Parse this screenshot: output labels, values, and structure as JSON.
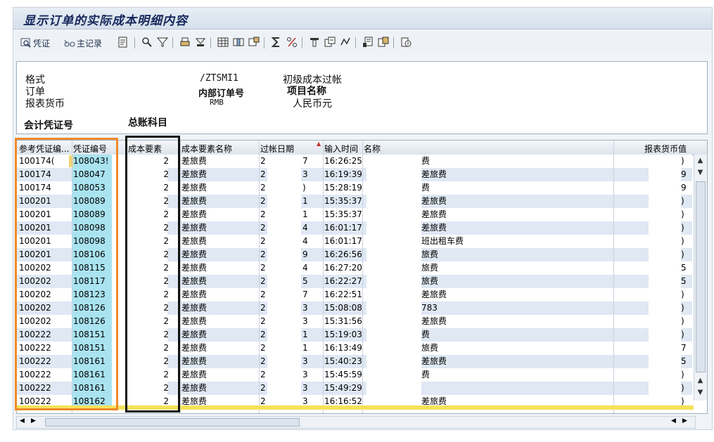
{
  "title": "显示订单的实际成本明细内容",
  "toolbar": {
    "voucher_label": "凭证",
    "master_label": "主记录"
  },
  "header": {
    "format_label": "格式",
    "format_value": "/ZTSMI1",
    "format_desc": "初级成本过帐",
    "order_label": "订单",
    "order_value": "内部订单号",
    "order_desc": "项目名称",
    "currency_label": "报表货币",
    "currency_value": "RMB",
    "currency_desc": "人民币元",
    "voucher_no_label": "会计凭证号",
    "gl_account_label": "总账科目"
  },
  "columns": [
    "参考凭证编...",
    "凭证编号",
    "成本要素",
    "成本要素名称",
    "过帐日期",
    "输入时间",
    "名称",
    "",
    "报表货币值"
  ],
  "rows": [
    {
      "ref": "100174(",
      "doc": "108043!",
      "ce": "2",
      "cename": "差旅费",
      "d1": "2",
      "d2": "7",
      "time": "16:26:25",
      "name": "费",
      "val": ")"
    },
    {
      "ref": "100174",
      "doc": "108047",
      "ce": "2",
      "cename": "差旅费",
      "d1": "2",
      "d2": "3",
      "time": "16:19:39",
      "name": "差旅费",
      "val": "9"
    },
    {
      "ref": "100174",
      "doc": "108053",
      "ce": "2",
      "cename": "差旅费",
      "d1": "2",
      "d2": ")",
      "time": "15:28:19",
      "name": "费",
      "val": "9"
    },
    {
      "ref": "100201",
      "doc": "108089",
      "ce": "2",
      "cename": "差旅费",
      "d1": "2",
      "d2": "1",
      "time": "15:35:37",
      "name": "差旅费",
      "val": ")"
    },
    {
      "ref": "100201",
      "doc": "108089",
      "ce": "2",
      "cename": "差旅费",
      "d1": "2",
      "d2": "1",
      "time": "15:35:37",
      "name": "差旅费",
      "val": ")"
    },
    {
      "ref": "100201",
      "doc": "108098",
      "ce": "2",
      "cename": "差旅费",
      "d1": "2",
      "d2": "4",
      "time": "16:01:17",
      "name": "差旅费",
      "val": ")"
    },
    {
      "ref": "100201",
      "doc": "108098",
      "ce": "2",
      "cename": "差旅费",
      "d1": "2",
      "d2": "4",
      "time": "16:01:17",
      "name": "班出租车费",
      "val": ")"
    },
    {
      "ref": "100201",
      "doc": "108106",
      "ce": "2",
      "cename": "差旅费",
      "d1": "2",
      "d2": "9",
      "time": "16:26:56",
      "name": "旅费",
      "val": ")"
    },
    {
      "ref": "100202",
      "doc": "108115",
      "ce": "2",
      "cename": "差旅费",
      "d1": "2",
      "d2": "4",
      "time": "16:27:20",
      "name": "旅费",
      "val": "5"
    },
    {
      "ref": "100202",
      "doc": "108117",
      "ce": "2",
      "cename": "差旅费",
      "d1": "2",
      "d2": "5",
      "time": "16:22:27",
      "name": "旅费",
      "val": "5"
    },
    {
      "ref": "100202",
      "doc": "108123",
      "ce": "2",
      "cename": "差旅费",
      "d1": "2",
      "d2": "7",
      "time": "16:22:51",
      "name": "差旅费",
      "val": ")"
    },
    {
      "ref": "100202",
      "doc": "108126",
      "ce": "2",
      "cename": "差旅费",
      "d1": "2",
      "d2": "3",
      "time": "15:08:08",
      "name": "783",
      "val": ")"
    },
    {
      "ref": "100202",
      "doc": "108126",
      "ce": "2",
      "cename": "差旅费",
      "d1": "2",
      "d2": "3",
      "time": "15:31:56",
      "name": "差旅费",
      "val": ")"
    },
    {
      "ref": "100222",
      "doc": "108151",
      "ce": "2",
      "cename": "差旅费",
      "d1": "2",
      "d2": "1",
      "time": "15:19:03",
      "name": "费",
      "val": ")"
    },
    {
      "ref": "100222",
      "doc": "108151",
      "ce": "2",
      "cename": "差旅费",
      "d1": "2",
      "d2": "1",
      "time": "16:13:49",
      "name": "旅费",
      "val": "7"
    },
    {
      "ref": "100222",
      "doc": "108161",
      "ce": "2",
      "cename": "差旅费",
      "d1": "2",
      "d2": "3",
      "time": "15:40:23",
      "name": "差旅费",
      "val": "5"
    },
    {
      "ref": "100222",
      "doc": "108161",
      "ce": "2",
      "cename": "差旅费",
      "d1": "2",
      "d2": "3",
      "time": "15:45:59",
      "name": "费",
      "val": ")"
    },
    {
      "ref": "100222",
      "doc": "108161",
      "ce": "2",
      "cename": "差旅费",
      "d1": "2",
      "d2": "3",
      "time": "15:49:29",
      "name": "",
      "val": ")"
    },
    {
      "ref": "100222",
      "doc": "108162",
      "ce": "2",
      "cename": "差旅费",
      "d1": "2",
      "d2": "3",
      "time": "16:16:52",
      "name": "差旅费",
      "val": ")"
    }
  ],
  "colors": {
    "stripe": "#dfe8f3",
    "doc_col": "#a9e3f0",
    "accent": "#f08a2b",
    "total": "#f5e25a"
  }
}
